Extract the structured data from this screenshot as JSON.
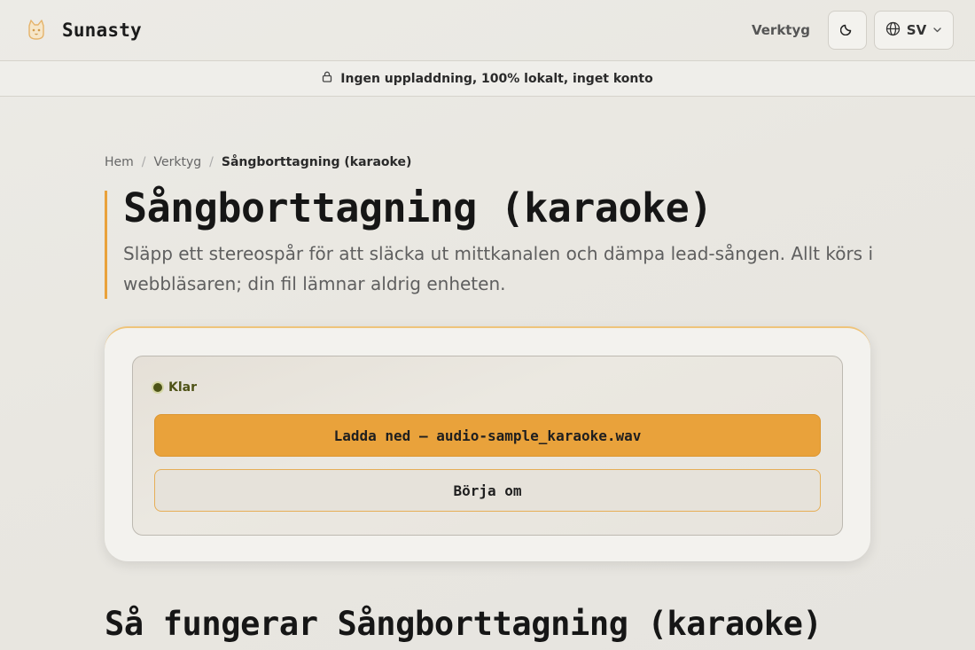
{
  "header": {
    "brand": "Sunasty",
    "logo_icon": "cat-logo-icon",
    "nav_tools": "Verktyg",
    "theme_icon": "moon-icon",
    "lang_icon": "globe-icon",
    "lang_label": "SV",
    "lang_chevron_icon": "chevron-down-icon"
  },
  "banner": {
    "icon": "lock-icon",
    "text": "Ingen uppladdning, 100% lokalt, inget konto"
  },
  "breadcrumb": {
    "items": [
      "Hem",
      "Verktyg"
    ],
    "separator": "/",
    "current": "Sångborttagning (karaoke)"
  },
  "hero": {
    "title": "Sångborttagning (karaoke)",
    "description": "Släpp ett stereospår för att släcka ut mittkanalen och dämpa lead-sången. Allt körs i webbläsaren; din fil lämnar aldrig enheten."
  },
  "tool": {
    "status": "Klar",
    "download_button": "Ladda ned — audio-sample_karaoke.wav",
    "restart_button": "Börja om"
  },
  "section": {
    "how_title": "Så fungerar Sångborttagning (karaoke)"
  },
  "colors": {
    "accent": "#e9a23b",
    "status_dot": "#4d5417"
  }
}
